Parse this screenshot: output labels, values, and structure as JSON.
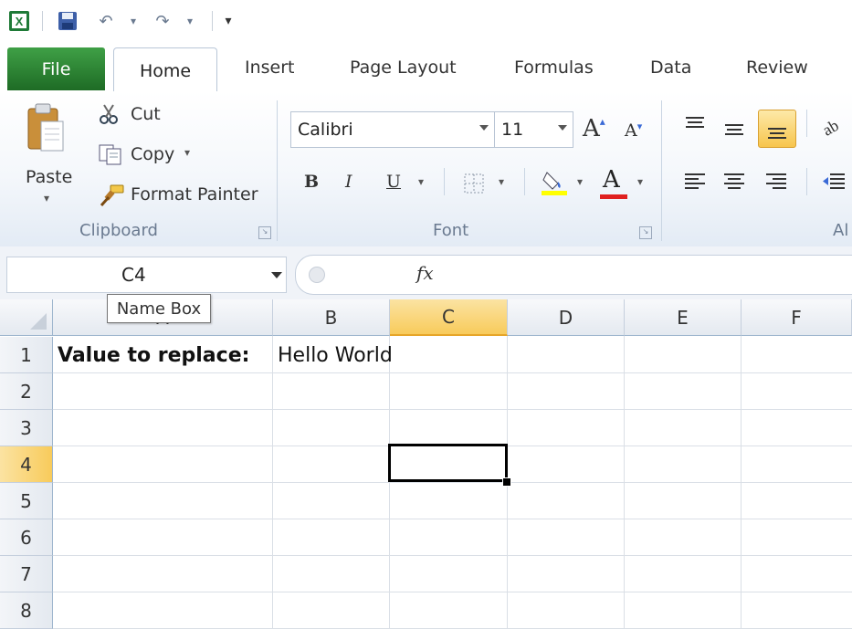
{
  "quick_access": {
    "undo_glyph": "↶",
    "redo_glyph": "↷",
    "customize_glyph": "▾"
  },
  "tabs": [
    "File",
    "Home",
    "Insert",
    "Page Layout",
    "Formulas",
    "Data",
    "Review"
  ],
  "clipboard": {
    "paste_label": "Paste",
    "cut_label": "Cut",
    "copy_label": "Copy",
    "format_painter_label": "Format Painter",
    "group_label": "Clipboard"
  },
  "font": {
    "font_name": "Calibri",
    "font_size": "11",
    "bold": "B",
    "italic": "I",
    "underline": "U",
    "font_color_glyph": "A",
    "group_label": "Font"
  },
  "alignment": {
    "group_label_partial": "Al"
  },
  "formula_bar": {
    "name_box_value": "C4",
    "fx_label": "fx",
    "formula_value": "",
    "name_box_tooltip": "Name Box"
  },
  "sheet": {
    "columns": [
      "A",
      "B",
      "C",
      "D",
      "E",
      "F"
    ],
    "selected_column": "C",
    "rows": [
      "1",
      "2",
      "3",
      "4",
      "5",
      "6",
      "7",
      "8"
    ],
    "selected_row": "4",
    "cells": {
      "A1": "Value to replace:",
      "B1": "Hello World"
    },
    "active_cell": "C4"
  },
  "colors": {
    "file_tab": "#2e7d32",
    "selection_header": "#f8cb5b",
    "highlight_yellow": "#ffff00",
    "font_red": "#e02020"
  }
}
